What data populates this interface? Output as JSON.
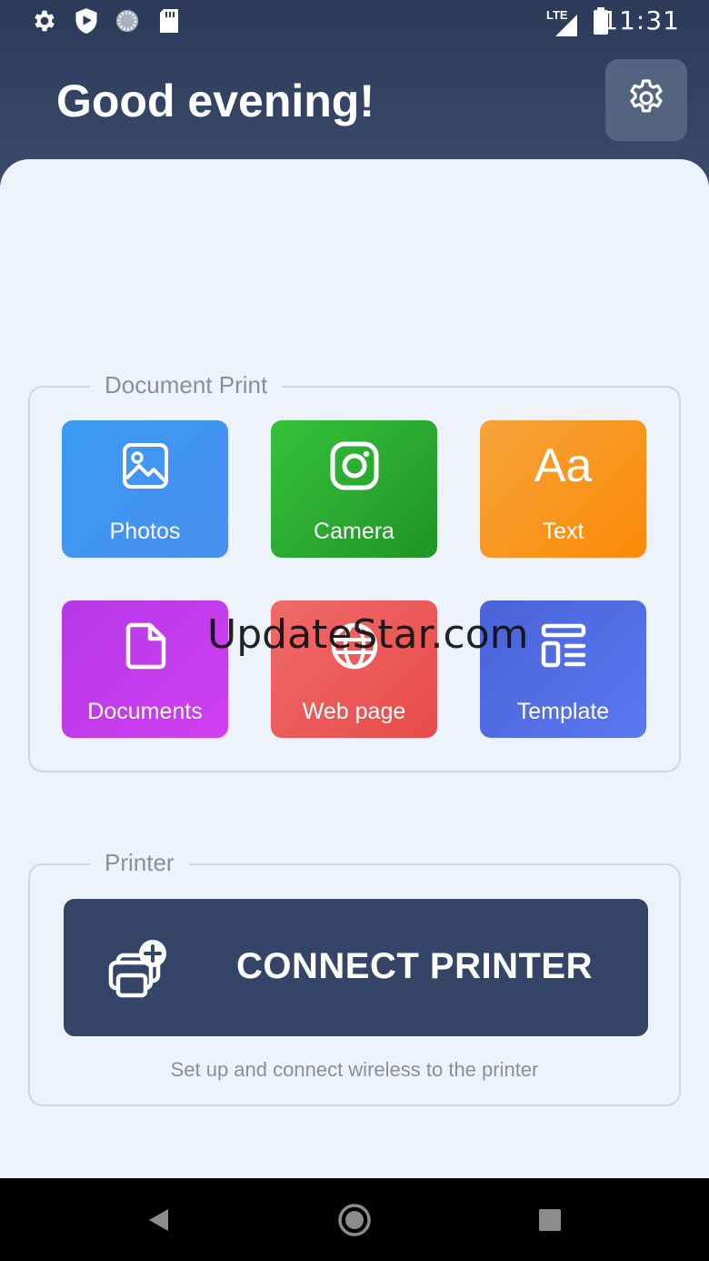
{
  "status_bar": {
    "time": "11:31",
    "network": "LTE",
    "icons": [
      "settings-icon",
      "shield-play-icon",
      "loading-circle-icon",
      "sd-card-icon",
      "signal-icon",
      "battery-icon"
    ]
  },
  "header": {
    "greeting": "Good evening!",
    "settings_icon": "gear-icon"
  },
  "document_print": {
    "title": "Document Print",
    "tiles": [
      {
        "label": "Photos",
        "icon": "image-icon",
        "color": "#3a9bf5"
      },
      {
        "label": "Camera",
        "icon": "camera-icon",
        "color": "#2aa82f"
      },
      {
        "label": "Text",
        "icon": "text-aa-icon",
        "glyph": "Aa",
        "color": "#f8951e"
      },
      {
        "label": "Documents",
        "icon": "document-icon",
        "color": "#c23cec"
      },
      {
        "label": "Web page",
        "icon": "globe-icon",
        "color": "#ec5a5a"
      },
      {
        "label": "Template",
        "icon": "template-icon",
        "color": "#5270e6"
      }
    ]
  },
  "printer": {
    "title": "Printer",
    "connect_label": "CONNECT PRINTER",
    "connect_icon": "printer-add-icon",
    "description": "Set up and connect wireless to the printer"
  },
  "watermark": "UpdateStar.com",
  "nav_bar": {
    "buttons": [
      "back-icon",
      "home-icon",
      "recents-icon"
    ]
  },
  "colors": {
    "header_bg": "#2f3f60",
    "content_bg": "#eef2fb",
    "button_bg": "#354568"
  }
}
